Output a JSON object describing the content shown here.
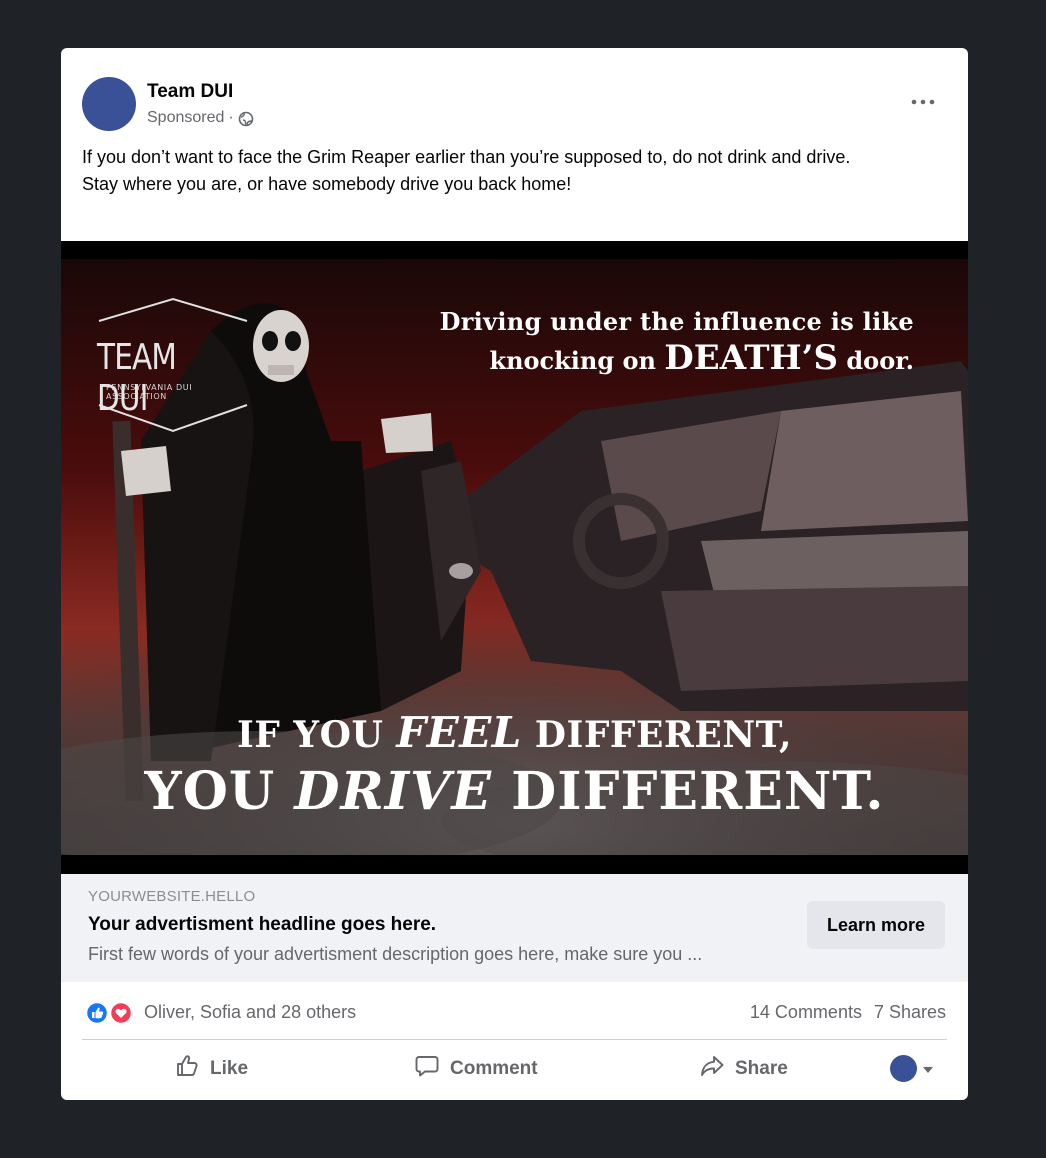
{
  "post": {
    "page_name": "Team DUI",
    "sponsored_label": "Sponsored",
    "separator": "·",
    "privacy_icon": "globe-icon",
    "more_icon": "more-options-icon",
    "text_line_1": "If you don’t want to face the Grim Reaper earlier than you’re supposed to, do not drink and drive.",
    "text_line_2": "Stay where you are, or have somebody drive you back home!"
  },
  "image": {
    "logo_main": "TEAM DUI",
    "logo_sub": "PENNSYLVANIA DUI ASSOCIATION",
    "headline_line_1": "Driving under the influence is like",
    "headline_line_2a": "knocking on ",
    "headline_line_2b": "DEATH’S",
    "headline_line_2c": " door.",
    "tagline_1a": "IF YOU ",
    "tagline_1b": "FEEL",
    "tagline_1c": " DIFFERENT,",
    "tagline_2a": "YOU ",
    "tagline_2b": "DRIVE",
    "tagline_2c": " DIFFERENT."
  },
  "link_preview": {
    "domain": "YOURWEBSITE.HELLO",
    "headline": "Your advertisment headline goes here.",
    "description": "First few words of your advertisment description goes here, make sure you ...",
    "cta_label": "Learn more"
  },
  "engagement": {
    "reactions": [
      "like-reaction-icon",
      "love-reaction-icon"
    ],
    "reaction_names": "Oliver, Sofia and 28 others",
    "comments": "14 Comments",
    "shares": "7 Shares"
  },
  "actions": {
    "like": "Like",
    "comment": "Comment",
    "share": "Share"
  },
  "colors": {
    "background": "#1f2227",
    "card": "#ffffff",
    "avatar": "#3b5197",
    "link_bar": "#f0f2f5",
    "button": "#e4e6eb",
    "secondary_text": "#65676b",
    "like_blue": "#1877f2",
    "love_red": "#f33e58"
  }
}
